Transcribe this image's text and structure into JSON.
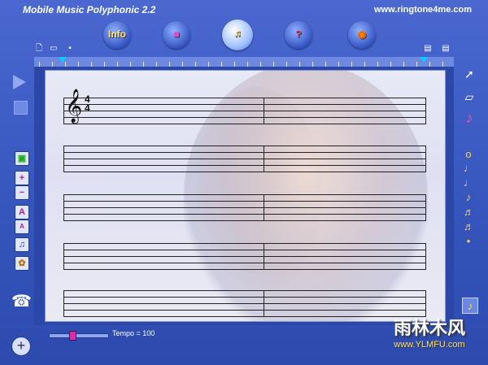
{
  "app": {
    "title": "Mobile Music Polyphonic  2.2",
    "website": "www.ringtone4me.com"
  },
  "toolbar": {
    "info_label": "Info",
    "buttons": [
      "Info",
      "instrument",
      "score-editor",
      "help-book",
      "save-disk"
    ]
  },
  "tempo": {
    "label": "Tempo = 100",
    "value": 100
  },
  "score": {
    "time_signature_top": "4",
    "time_signature_bottom": "4",
    "clef": "𝄞",
    "staves": 5,
    "measures_per_staff": 2
  },
  "left_tools": {
    "volume_up": "+",
    "volume_down": "−",
    "pitch_up": "A",
    "pitch_down": "A"
  },
  "add_button": "+",
  "watermark": {
    "title": "雨林木风",
    "url": "www.YLMFU.com"
  },
  "colors": {
    "frame": "#3555bc",
    "accent_pink": "#d630a6",
    "note_yellow": "#ffd34a"
  }
}
